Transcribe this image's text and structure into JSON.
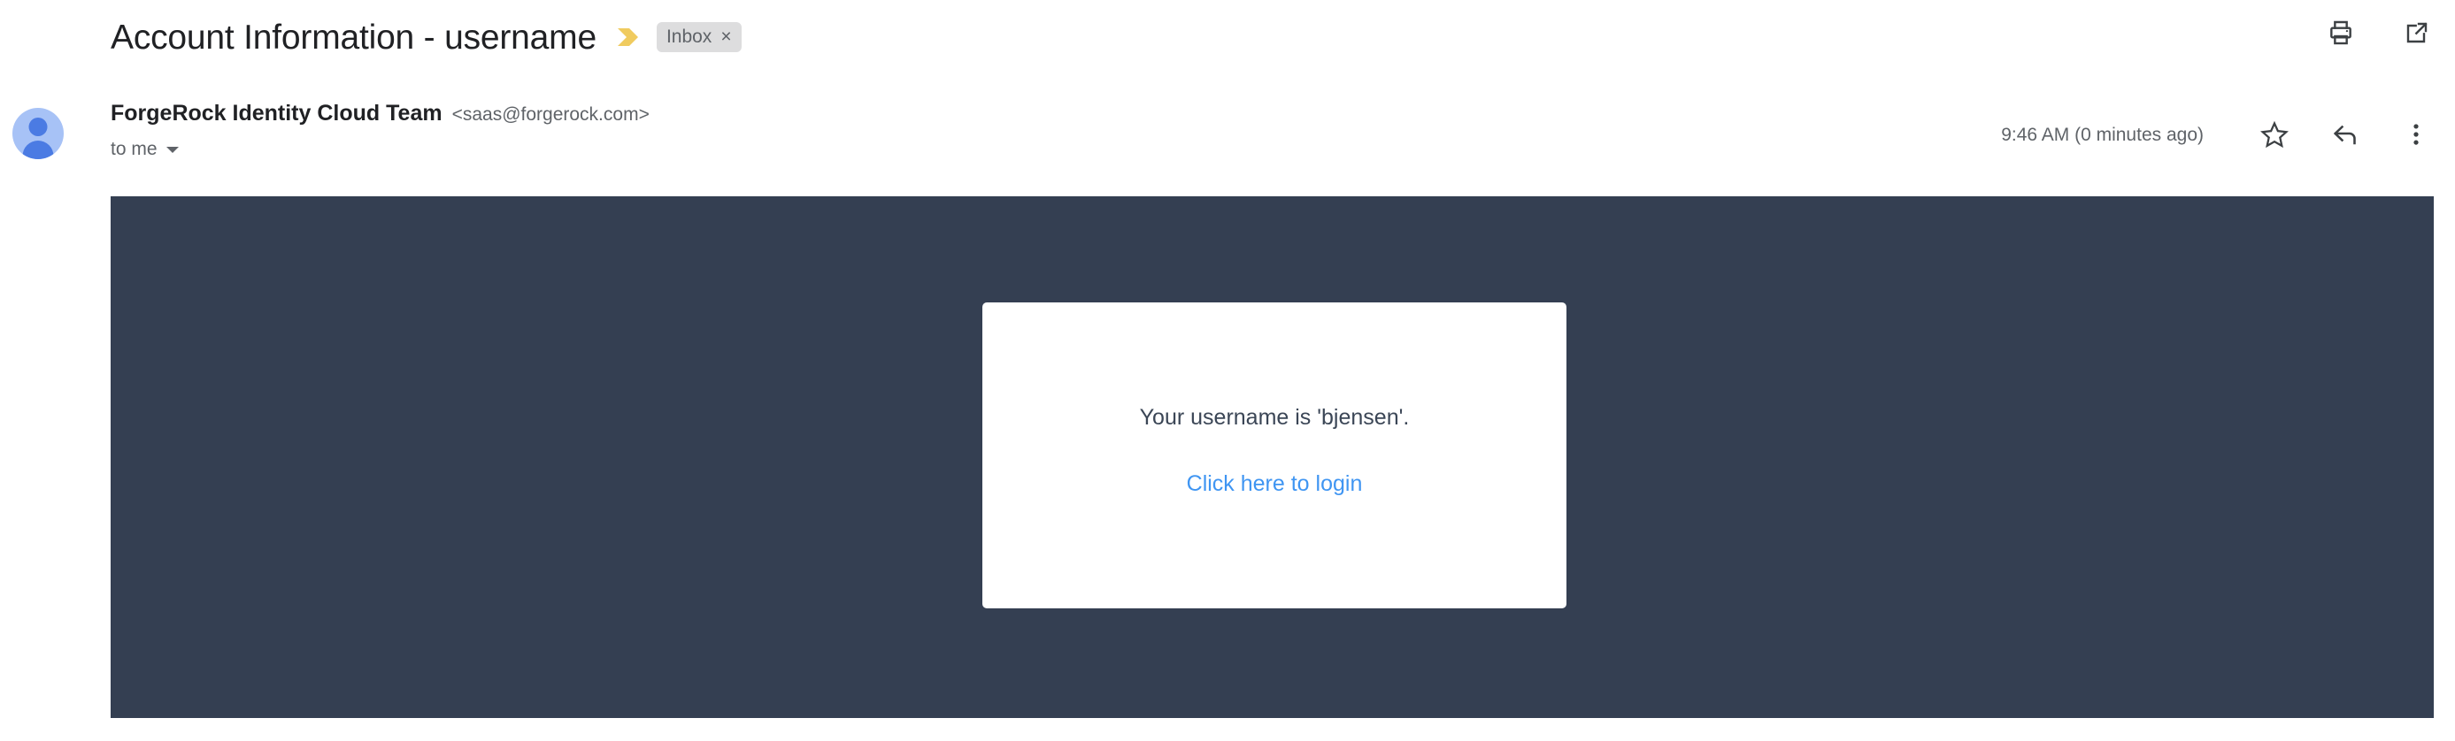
{
  "subject": {
    "title": "Account Information - username",
    "important_marker_icon": "important-chevron-icon",
    "important_marker_color": "#f0cb5f",
    "label_chip": {
      "text": "Inbox",
      "remove": "×",
      "background": "#ddddde",
      "text_color": "#5f6368"
    }
  },
  "header_actions": [
    {
      "icon": "print-icon",
      "label": "Print all"
    },
    {
      "icon": "open-in-new-window-icon",
      "label": "Open in new window"
    }
  ],
  "sender": {
    "avatar_icon": "avatar",
    "avatar_background": "#a7c2f6",
    "avatar_figure_color": "#4b7be3",
    "name": "ForgeRock Identity Cloud Team",
    "email": "<saas@forgerock.com>",
    "recipient": "to me",
    "recipient_caret_icon": "caret-down-icon",
    "timestamp": "9:46 AM (0 minutes ago)"
  },
  "sender_actions": [
    {
      "icon": "star-icon",
      "label": "Star"
    },
    {
      "icon": "reply-arrow-icon",
      "label": "Reply"
    },
    {
      "icon": "more-vertical-icon",
      "label": "More"
    }
  ],
  "body": {
    "background_color": "#343f52",
    "card": {
      "background_color": "#ffffff",
      "username_text": "Your username is 'bjensen'.",
      "username_text_color": "#3b4656",
      "link_text": "Click here to login",
      "link_color": "#3f95f2"
    }
  }
}
